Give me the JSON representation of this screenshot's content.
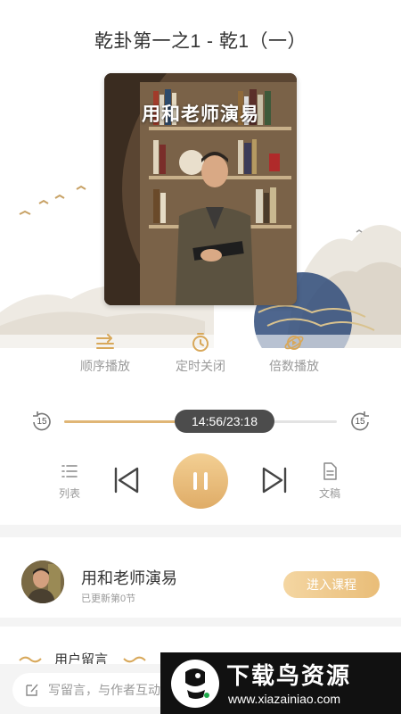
{
  "player": {
    "track_title": "乾卦第一之1 - 乾1（一）",
    "cover_title": "用和老师演易",
    "options": [
      {
        "label": "顺序播放",
        "icon": "sequential-play-icon"
      },
      {
        "label": "定时关闭",
        "icon": "timer-icon"
      },
      {
        "label": "倍数播放",
        "icon": "playback-speed-icon"
      }
    ],
    "skip_back_seconds": "15",
    "skip_forward_seconds": "15",
    "time_display": "14:56/23:18",
    "progress_fraction": 0.641,
    "list_label": "列表",
    "transcript_label": "文稿",
    "state": "playing",
    "accent_color": "#e0b676"
  },
  "author": {
    "name": "用和老师演易",
    "subtitle": "已更新第0节",
    "enter_label": "进入课程"
  },
  "comments": {
    "title": "用户留言",
    "input_placeholder": "写留言，与作者互动"
  },
  "watermark": {
    "title": "下载鸟资源",
    "url": "www.xiazainiao.com"
  }
}
